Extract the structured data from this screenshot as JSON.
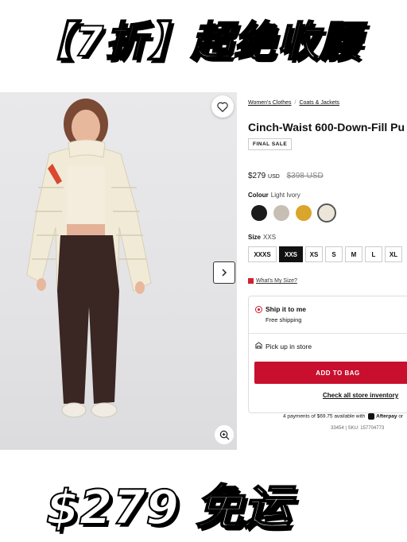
{
  "promo": {
    "top_text": "【7折】超绝收腰",
    "bottom_text": "$279 免运"
  },
  "gallery": {
    "favorite_icon": "heart-icon",
    "next_icon": "chevron-right-icon",
    "zoom_icon": "zoom-in-icon"
  },
  "breadcrumb": {
    "items": [
      "Women's Clothes",
      "Coats & Jackets"
    ],
    "separator": "/"
  },
  "product": {
    "title": "Cinch-Waist 600-Down-Fill Pu",
    "badge": "FINAL SALE",
    "price": "$279",
    "price_currency": "USD",
    "original_price": "$398 USD"
  },
  "colour": {
    "label": "Colour",
    "selected": "Light Ivory",
    "swatches": [
      "#1b1b1b",
      "#c7bfb3",
      "#d9a52a",
      "#ece6d9"
    ]
  },
  "size": {
    "label": "Size",
    "selected": "XXS",
    "options": [
      "XXXS",
      "XXS",
      "XS",
      "S",
      "M",
      "L",
      "XL"
    ]
  },
  "fit_link": "What's My Size?",
  "fulfillment": {
    "ship_title": "Ship it to me",
    "ship_sub": "Free shipping",
    "pickup": "Pick up in store",
    "add_to_bag": "ADD TO BAG",
    "check_inventory": "Check all store inventory"
  },
  "payment": {
    "text": "4 payments of $69.75 available with",
    "afterpay": "Afterpay",
    "or": "or"
  },
  "sku": "33454 | SKU: 157704773",
  "colors": {
    "accent": "#c8102e"
  }
}
